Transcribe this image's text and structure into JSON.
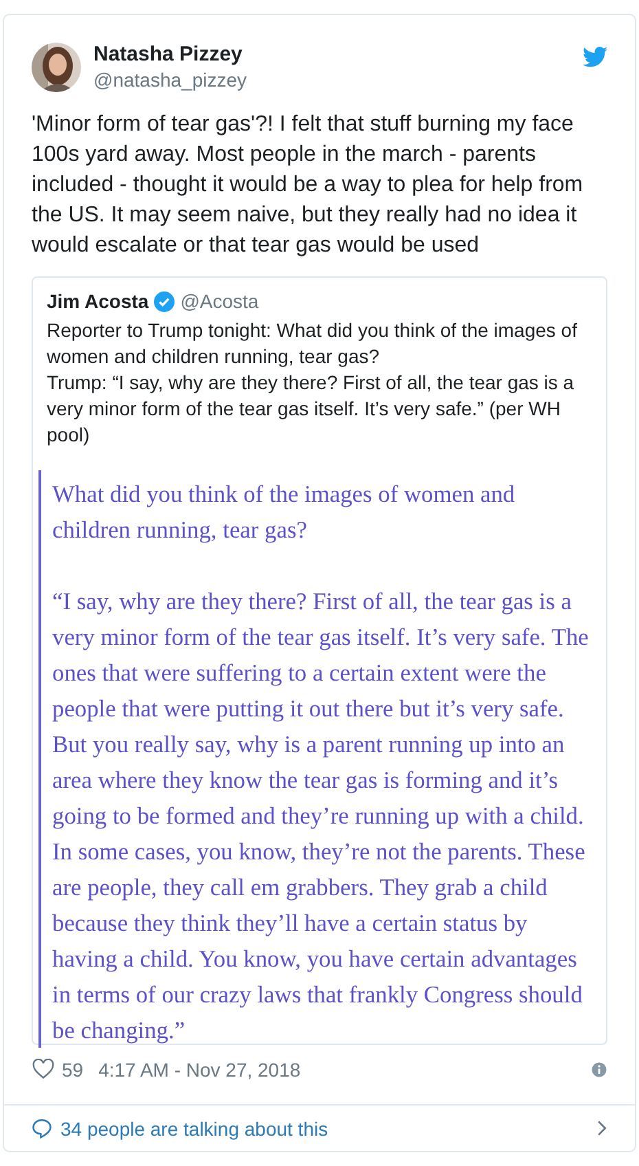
{
  "author": {
    "name": "Natasha Pizzey",
    "handle": "@natasha_pizzey"
  },
  "text": "'Minor form of tear gas'?! I felt that stuff burning my face 100s yard away. Most people in the march - parents included - thought it would be a way to plea for help from the US. It may seem naive, but they really had no idea it would escalate or that tear gas would be used",
  "quoted": {
    "name": "Jim Acosta",
    "verified": true,
    "handle": "@Acosta",
    "lines": [
      "Reporter to Trump tonight: What did you think of the images of women and children running, tear gas?",
      "Trump:  “I say, why are they there? First of all, the tear gas is a very minor form of the tear gas itself. It’s very safe.” (per WH pool)"
    ],
    "image_paragraphs": [
      "What did you think of the images of women and children running, tear gas?",
      "“I say, why are they there? First of all, the tear gas is a very minor form of the tear gas itself. It’s very safe. The ones that were suffering to a certain extent were the people that were putting it out there but it’s very safe. But you really say, why is a parent running up into an area where they know the tear gas is forming and it’s going to be formed and they’re running up with a child. In some cases, you know, they’re not the parents. These are people, they call em grabbers. They grab a child because they think they’ll have a certain status by having a child. You know, you have certain advantages in terms of our crazy laws that frankly Congress should be changing.”"
    ]
  },
  "likes": "59",
  "timestamp": "4:17 AM - Nov 27, 2018",
  "talking": "34 people are talking about this"
}
